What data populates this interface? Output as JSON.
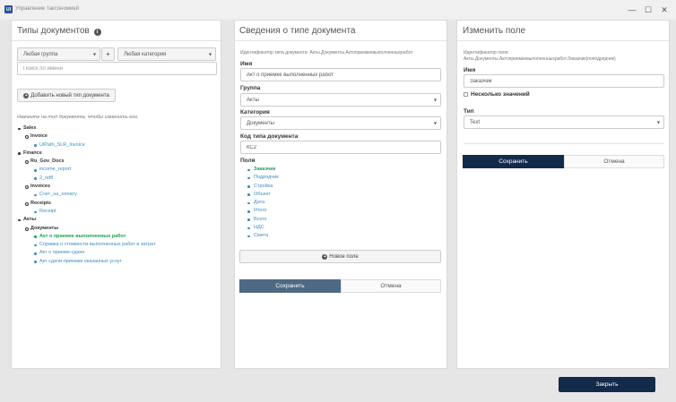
{
  "window": {
    "app_icon": "UI",
    "title": "Управление таксономией",
    "controls": {
      "minimize": "—",
      "maximize": "☐",
      "close": "✕"
    }
  },
  "left": {
    "title": "Типы документов",
    "info_icon": "i",
    "group_select": "Любая группа",
    "plus": "+",
    "category_select": "Любая категория",
    "search_placeholder": "Поиск по имени",
    "add_button": "Добавить новый тип документа",
    "hint": "Нажмите на тип документа, чтобы изменить его.",
    "tree": [
      {
        "level": 1,
        "label": "Sales"
      },
      {
        "level": 2,
        "label": "Invoice"
      },
      {
        "level": 3,
        "label": "UiPath_SLR_Invoice"
      },
      {
        "level": 1,
        "label": "Finance"
      },
      {
        "level": 2,
        "label": "Ru_Gov_Docs"
      },
      {
        "level": 3,
        "label": "income_report"
      },
      {
        "level": 3,
        "label": "2_ndfl"
      },
      {
        "level": 2,
        "label": "Invoices"
      },
      {
        "level": 3,
        "label": "Счет_на_оплату"
      },
      {
        "level": 2,
        "label": "Receipts"
      },
      {
        "level": 3,
        "label": "Receipt"
      },
      {
        "level": 1,
        "label": "Акты"
      },
      {
        "level": 2,
        "label": "Документы"
      },
      {
        "level": 3,
        "label": "Акт о приемке выполненных работ",
        "selected": true
      },
      {
        "level": 3,
        "label": "Справка о стоимости выполненных работ и затрат"
      },
      {
        "level": 3,
        "label": "Акт о приеме-сдаче"
      },
      {
        "level": 3,
        "label": "Акт сдачи-приемки оказанных услуг"
      }
    ]
  },
  "middle": {
    "title": "Сведения о типе документа",
    "id_line": "Идентификатор типа документа: Акты.Документы.Актоприемкевыполненныхработ",
    "name_label": "Имя",
    "name_value": "Акт о приемке выполненных работ",
    "group_label": "Группа",
    "group_value": "Акты",
    "category_label": "Категория",
    "category_value": "Документы",
    "code_label": "Код типа документа",
    "code_value": "КС2",
    "fields_label": "Поля",
    "fields": [
      "Заказчик",
      "Подрядчик",
      "Стройка",
      "Объект",
      "Дата",
      "Итого",
      "Всего",
      "НДС",
      "Смета"
    ],
    "new_field_button": "Новое поле",
    "save_button": "Сохранить",
    "cancel_button": "Отмена"
  },
  "right": {
    "title": "Изменить поле",
    "id_label": "Идентификатор поля:",
    "id_value": "Акты.Документы.Актоприемкевыполненныхработ.Заказчик(поподрядчик)",
    "name_label": "Имя",
    "name_value": "Заказчик",
    "multi_label": "Несколько значений",
    "type_label": "Тип",
    "type_value": "Text",
    "save_button": "Сохранить",
    "cancel_button": "Отмена"
  },
  "footer": {
    "close_button": "Закрыть"
  }
}
